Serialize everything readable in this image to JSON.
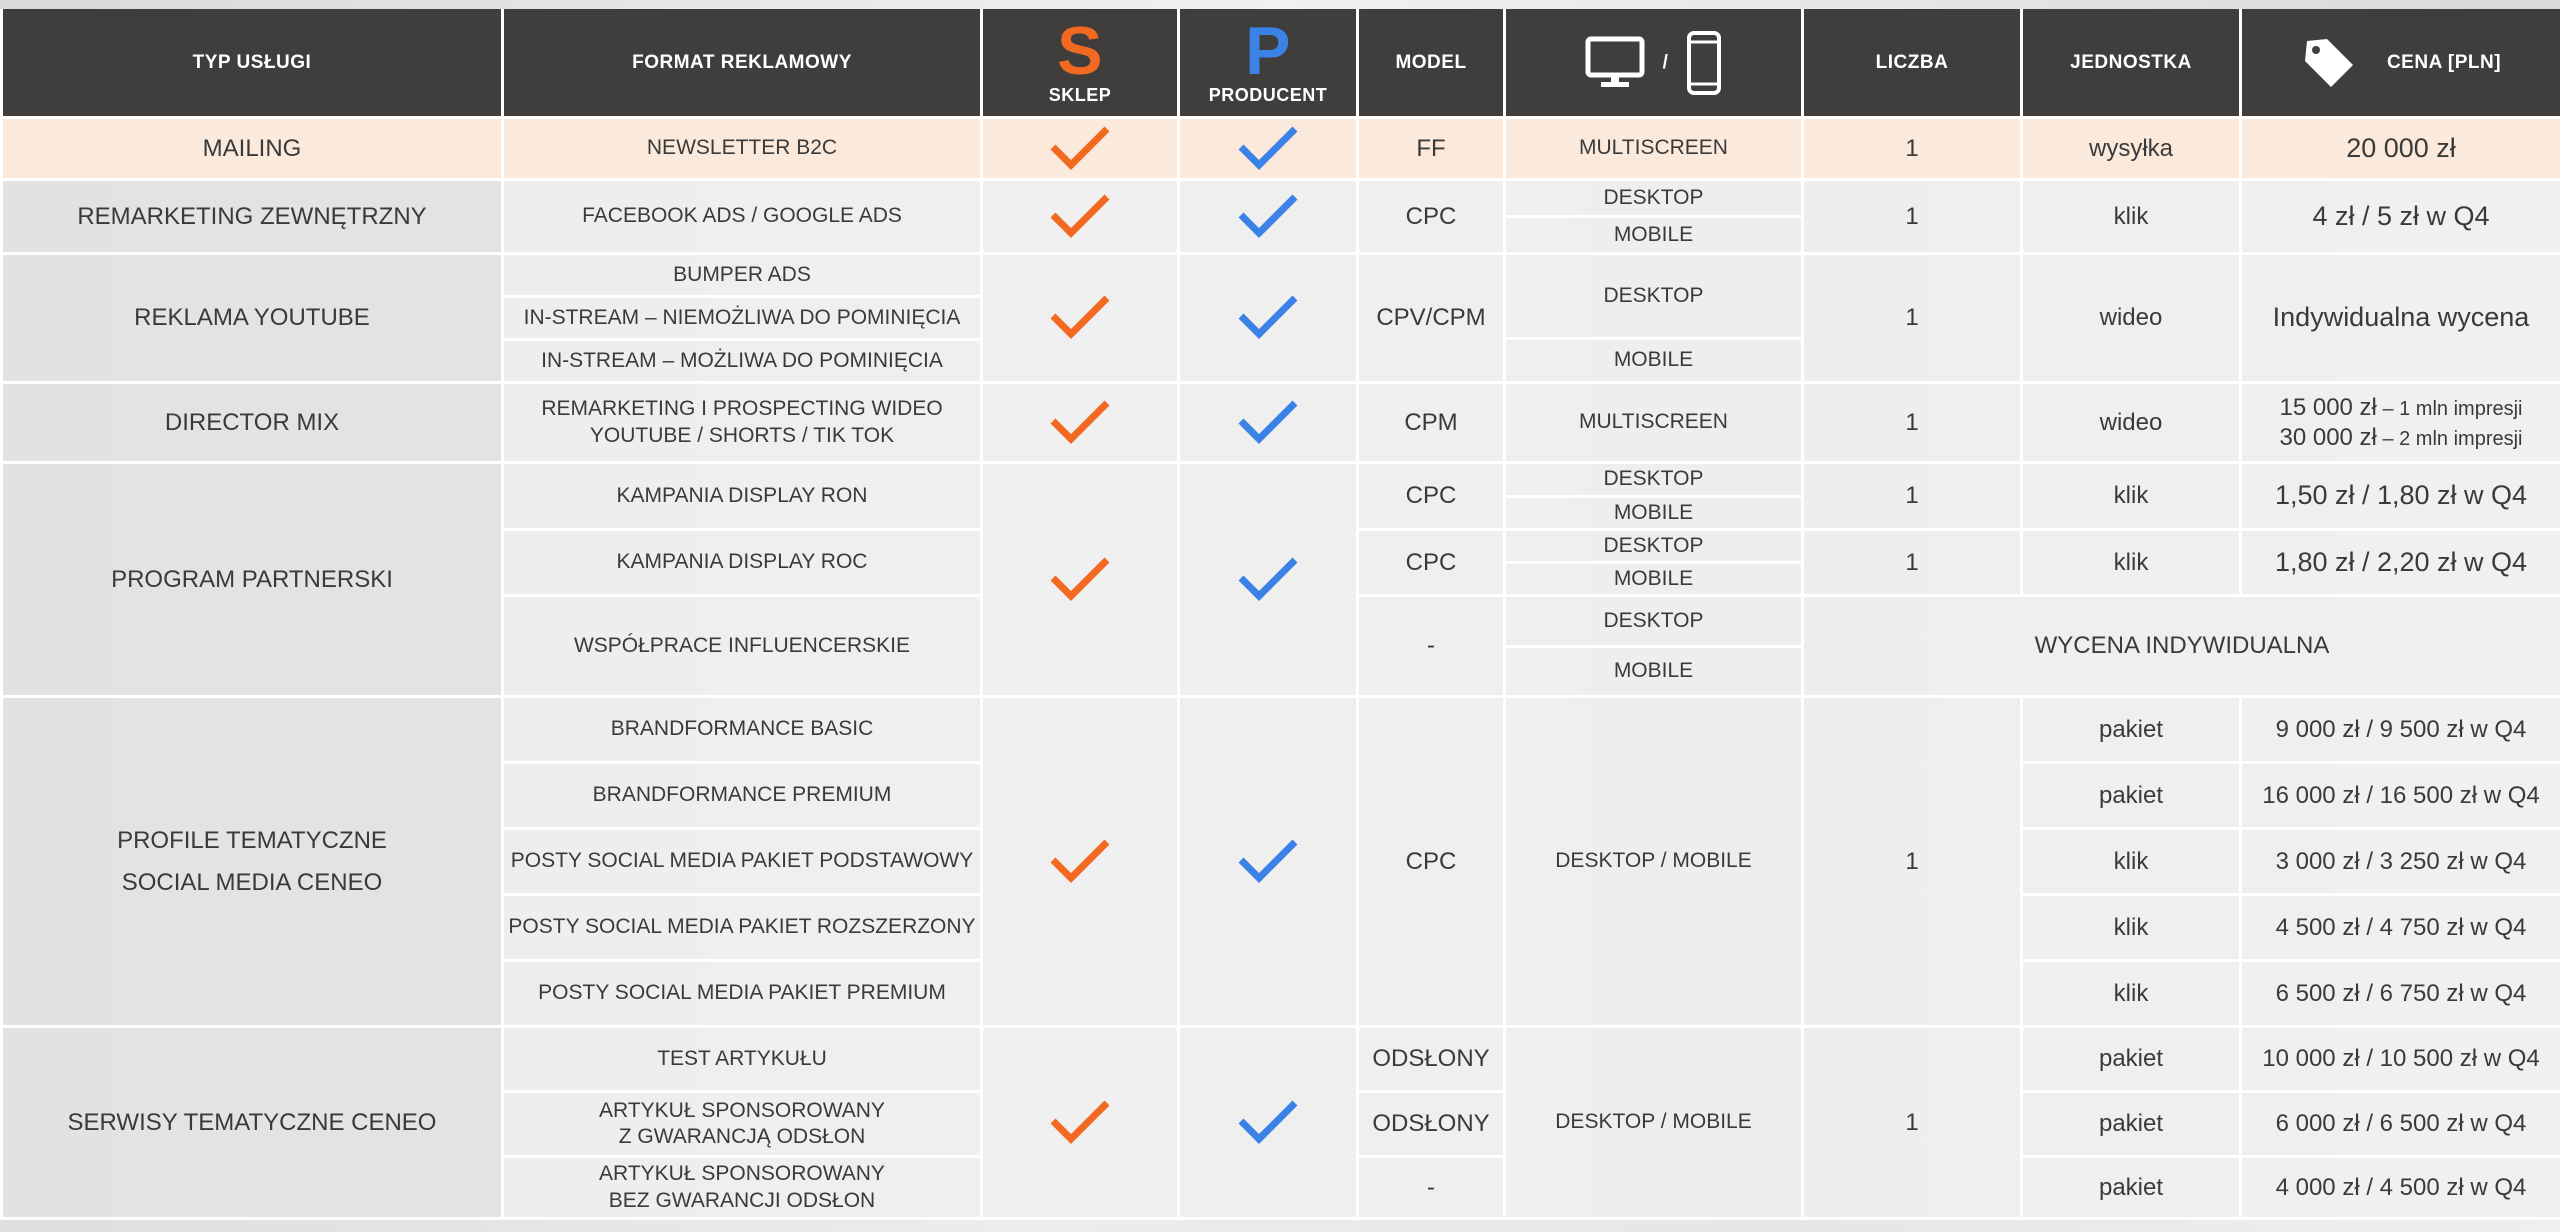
{
  "header": {
    "typ_uslugi": "TYP  USŁUGI",
    "format": "FORMAT REKLAMOWY",
    "sklep_logo": "S",
    "sklep": "SKLEP",
    "producent_logo": "P",
    "producent": "PRODUCENT",
    "model": "MODEL",
    "device_sep": "/",
    "liczba": "LICZBA",
    "jednostka": "JEDNOSTKA",
    "cena": "CENA [PLN]"
  },
  "colors": {
    "header_bg": "#3f3e3d",
    "sklep_orange": "#f26a21",
    "producent_blue": "#3b82e6",
    "highlight_row": "#fbeadc"
  },
  "icons": {
    "desktop": "monitor-icon",
    "mobile": "smartphone-icon",
    "price": "price-tag-icon",
    "check": "checkmark-icon"
  },
  "rows": {
    "mailing": {
      "type": "MAILING",
      "format": "NEWSLETTER B2C",
      "model": "FF",
      "device": "MULTISCREEN",
      "num": "1",
      "unit": "wysyłka",
      "price": "20 000 zł"
    },
    "remarketing": {
      "type": "REMARKETING ZEWNĘTRZNY",
      "format": "FACEBOOK ADS / GOOGLE ADS",
      "model": "CPC",
      "device1": "DESKTOP",
      "device2": "MOBILE",
      "num": "1",
      "unit": "klik",
      "price": "4 zł / 5 zł w Q4"
    },
    "youtube": {
      "type": "REKLAMA YOUTUBE",
      "format1": "BUMPER ADS",
      "format2": "IN-STREAM – NIEMOŻLIWA DO POMINIĘCIA",
      "format3": "IN-STREAM – MOŻLIWA DO POMINIĘCIA",
      "model": "CPV/CPM",
      "device1": "DESKTOP",
      "device2": "MOBILE",
      "num": "1",
      "unit": "wideo",
      "price": "Indywidualna wycena"
    },
    "director": {
      "type": "DIRECTOR MIX",
      "format1": "REMARKETING I PROSPECTING WIDEO",
      "format2": "YOUTUBE / SHORTS / TIK TOK",
      "model": "CPM",
      "device": "MULTISCREEN",
      "num": "1",
      "unit": "wideo",
      "price1_main": "15 000 zł",
      "price1_minor": " – 1 mln impresji",
      "price2_main": "30 000 zł",
      "price2_minor": " – 2 mln impresji"
    },
    "partner": {
      "type": "PROGRAM PARTNERSKI",
      "ron": {
        "format": "KAMPANIA DISPLAY RON",
        "model": "CPC",
        "device1": "DESKTOP",
        "device2": "MOBILE",
        "num": "1",
        "unit": "klik",
        "price": "1,50 zł / 1,80 zł w Q4"
      },
      "roc": {
        "format": "KAMPANIA DISPLAY ROC",
        "model": "CPC",
        "device1": "DESKTOP",
        "device2": "MOBILE",
        "num": "1",
        "unit": "klik",
        "price": "1,80 zł / 2,20 zł w Q4"
      },
      "influencer": {
        "format": "WSPÓŁPRACE INFLUENCERSKIE",
        "model": "-",
        "device1": "DESKTOP",
        "device2": "MOBILE",
        "price": "WYCENA INDYWIDUALNA"
      }
    },
    "profile": {
      "type_line1": "PROFILE TEMATYCZNE",
      "type_line2": "SOCIAL MEDIA CENEO",
      "model": "CPC",
      "device": "DESKTOP / MOBILE",
      "num": "1",
      "items": [
        {
          "format": "BRANDFORMANCE BASIC",
          "unit": "pakiet",
          "price": "9 000 zł / 9 500 zł w Q4"
        },
        {
          "format": "BRANDFORMANCE PREMIUM",
          "unit": "pakiet",
          "price": "16 000 zł / 16 500 zł w Q4"
        },
        {
          "format": "POSTY SOCIAL MEDIA PAKIET PODSTAWOWY",
          "unit": "klik",
          "price": "3 000 zł / 3 250 zł w Q4"
        },
        {
          "format": "POSTY SOCIAL MEDIA PAKIET ROZSZERZONY",
          "unit": "klik",
          "price": "4 500 zł / 4 750 zł w Q4"
        },
        {
          "format": "POSTY SOCIAL MEDIA PAKIET PREMIUM",
          "unit": "klik",
          "price": "6 500 zł / 6 750 zł w Q4"
        }
      ]
    },
    "serwisy": {
      "type": "SERWISY TEMATYCZNE CENEO",
      "device": "DESKTOP / MOBILE",
      "num": "1",
      "items": [
        {
          "format1": "TEST ARTYKUŁU",
          "format2": "",
          "model": "ODSŁONY",
          "unit": "pakiet",
          "price": "10 000 zł / 10 500 zł w Q4"
        },
        {
          "format1": "ARTYKUŁ SPONSOROWANY",
          "format2": "Z GWARANCJĄ ODSŁON",
          "model": "ODSŁONY",
          "unit": "pakiet",
          "price": "6 000 zł / 6 500 zł w Q4"
        },
        {
          "format1": "ARTYKUŁ SPONSOROWANY",
          "format2": "BEZ GWARANCJI ODSŁON",
          "model": "-",
          "unit": "pakiet",
          "price": "4 000 zł / 4 500 zł w Q4"
        }
      ]
    }
  }
}
